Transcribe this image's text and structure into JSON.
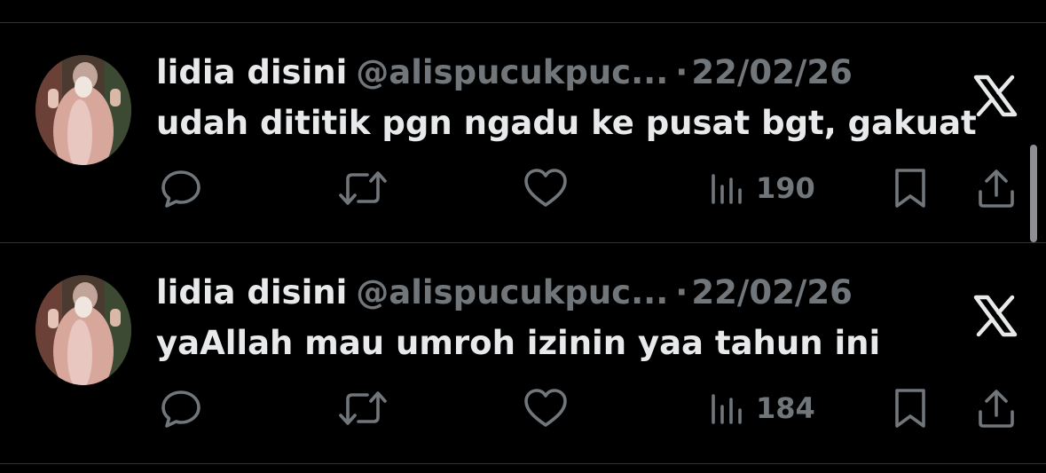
{
  "colors": {
    "background": "#000000",
    "divider": "#2f3336",
    "primary_text": "#e7e9ea",
    "secondary_text": "#71767b"
  },
  "tweets": [
    {
      "display_name": "lidia disini",
      "handle": "@alispucukpuc...",
      "separator": "·",
      "date": "22/02/26",
      "text": "udah dititik pgn ngadu ke pusat bgt, gakuat",
      "views": "190",
      "icons": [
        "reply-icon",
        "retweet-icon",
        "like-icon",
        "views-icon",
        "bookmark-icon",
        "share-icon",
        "x-logo-icon"
      ]
    },
    {
      "display_name": "lidia disini",
      "handle": "@alispucukpuc...",
      "separator": "·",
      "date": "22/02/26",
      "text": "yaAllah mau umroh izinin yaa tahun ini",
      "views": "184",
      "icons": [
        "reply-icon",
        "retweet-icon",
        "like-icon",
        "views-icon",
        "bookmark-icon",
        "share-icon",
        "x-logo-icon"
      ]
    }
  ]
}
